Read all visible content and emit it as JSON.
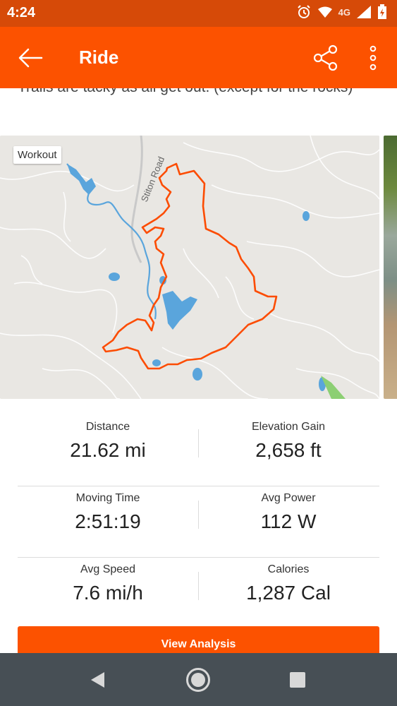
{
  "status_bar": {
    "time": "4:24",
    "network": "4G",
    "icons": [
      "alarm-icon",
      "wifi-icon",
      "signal-icon",
      "battery-charging-icon"
    ]
  },
  "app_bar": {
    "title": "Ride",
    "back_icon": "arrow-left-icon",
    "share_icon": "share-icon",
    "more_icon": "more-vert-icon"
  },
  "description": "Trails are tacky as all get out. (except for the rocks)",
  "map": {
    "chip_label": "Workout",
    "road_label": "Stiton Road",
    "route_color": "#fc4c02",
    "water_color": "#5aa5dc",
    "land_color": "#e9e7e3"
  },
  "stats": [
    [
      {
        "label": "Distance",
        "value": "21.62 mi"
      },
      {
        "label": "Elevation Gain",
        "value": "2,658 ft"
      }
    ],
    [
      {
        "label": "Moving Time",
        "value": "2:51:19"
      },
      {
        "label": "Avg Power",
        "value": "112 W"
      }
    ],
    [
      {
        "label": "Avg Speed",
        "value": "7.6 mi/h"
      },
      {
        "label": "Calories",
        "value": "1,287 Cal"
      }
    ]
  ],
  "actions": {
    "view_analysis": "View Analysis"
  },
  "colors": {
    "brand": "#fc5200",
    "status_bar": "#d64a08",
    "nav_bar": "#474f55"
  },
  "nav_bar": {
    "icons": [
      "nav-back-icon",
      "nav-home-icon",
      "nav-recent-icon"
    ]
  }
}
